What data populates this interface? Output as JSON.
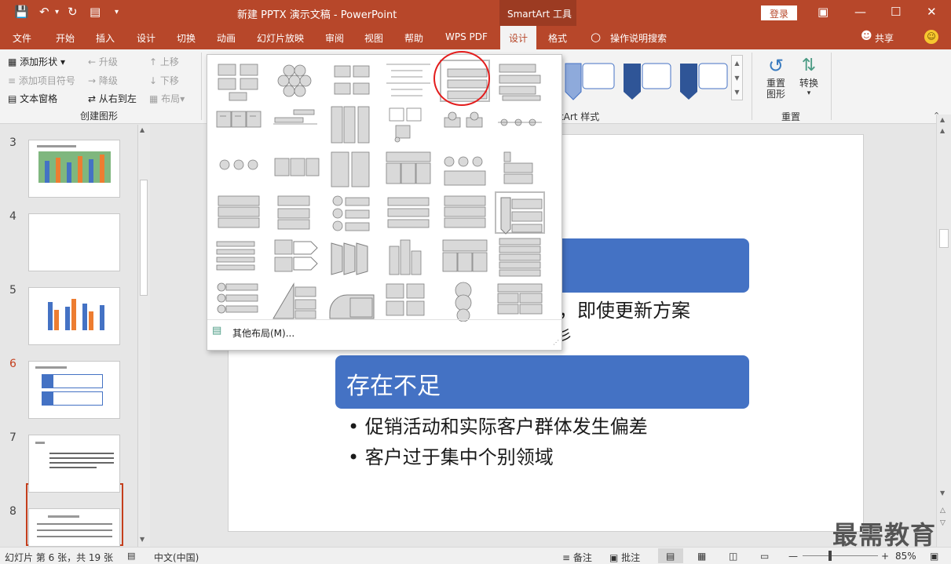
{
  "titlebar": {
    "doc_title": "新建 PPTX 演示文稿 - PowerPoint",
    "context_tab": "SmartArt 工具",
    "login": "登录"
  },
  "tabs": [
    "文件",
    "开始",
    "插入",
    "设计",
    "切换",
    "动画",
    "幻灯片放映",
    "审阅",
    "视图",
    "帮助",
    "WPS PDF",
    "设计",
    "格式"
  ],
  "tell_me": "操作说明搜索",
  "share": "共享",
  "ribbon": {
    "add_shape": "添加形状",
    "add_bullet": "添加项目符号",
    "text_pane": "文本窗格",
    "promote": "升级",
    "demote": "降级",
    "right_to_left": "从右到左",
    "move_up": "上移",
    "move_down": "下移",
    "layout": "布局",
    "group_create": "创建图形",
    "styles_label": "rtArt 样式",
    "reset_graphic": "重置图形",
    "reset_line1": "重置",
    "reset_line2": "图形",
    "convert": "转换",
    "group_reset": "重置"
  },
  "gallery": {
    "more_layouts": "其他布局(M)..."
  },
  "thumbnails": [
    {
      "num": "3"
    },
    {
      "num": "4"
    },
    {
      "num": "5"
    },
    {
      "num": "6",
      "selected": true
    },
    {
      "num": "7"
    },
    {
      "num": "8"
    }
  ],
  "slide": {
    "partial_text": "，即使更新方案",
    "partial_text2": "彡",
    "heading2": "存在不足",
    "bullets2": [
      "促销活动和实际客户群体发生偏差",
      "客户过于集中个别领域"
    ]
  },
  "status": {
    "slide_info": "幻灯片 第 6 张，共 19 张",
    "language": "中文(中国)",
    "notes": "备注",
    "comments": "批注",
    "zoom": "85%"
  },
  "watermark": "最需教育",
  "colors": {
    "accent": "#b7472a",
    "smartart_blue": "#4472c4",
    "highlight_circle": "#e31c1c"
  }
}
